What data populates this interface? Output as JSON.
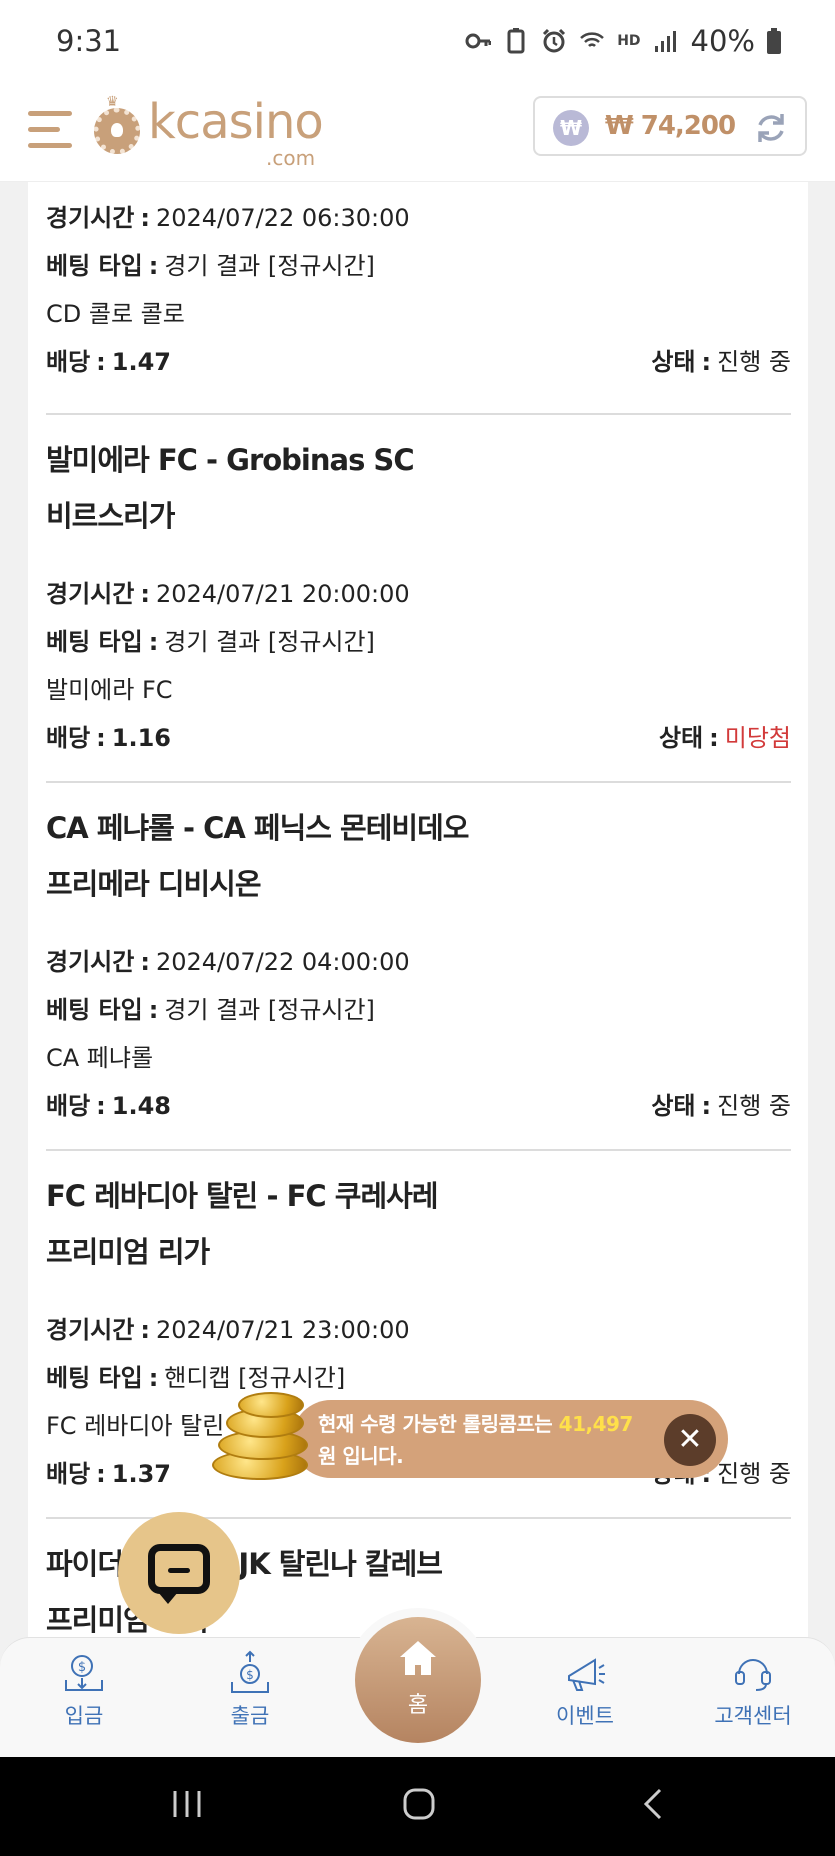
{
  "status_bar": {
    "time": "9:31",
    "network": "HD",
    "battery": "40%"
  },
  "header": {
    "logo_text": "kcasino",
    "logo_domain": ".com",
    "currency_symbol": "₩",
    "balance": "₩ 74,200"
  },
  "labels": {
    "time": "경기시간",
    "bet_type": "베팅 타입",
    "odds": "배당",
    "status": "상태",
    "colon": ":"
  },
  "bets": [
    {
      "match": "",
      "league": "",
      "time": "2024/07/22 06:30:00",
      "bet_type": "경기 결과 [정규시간]",
      "pick": "CD 콜로 콜로",
      "odds": "1.47",
      "status": "진행 중"
    },
    {
      "match": "발미에라 FC - Grobinas SC",
      "league": "비르스리가",
      "time": "2024/07/21 20:00:00",
      "bet_type": "경기 결과 [정규시간]",
      "pick": "발미에라 FC",
      "odds": "1.16",
      "status": "미당첨"
    },
    {
      "match": "CA 페냐롤 - CA 페닉스 몬테비데오",
      "league": "프리메라 디비시온",
      "time": "2024/07/22 04:00:00",
      "bet_type": "경기 결과 [정규시간]",
      "pick": "CA 페냐롤",
      "odds": "1.48",
      "status": "진행 중"
    },
    {
      "match": "FC 레바디아 탈린 - FC 쿠레사레",
      "league": "프리미엄 리가",
      "time": "2024/07/21 23:00:00",
      "bet_type": "핸디캡 [정규시간]",
      "pick": "FC 레바디아 탈린",
      "odds": "1.37",
      "status": "진행 중"
    },
    {
      "match": "파이더 스콘드 - JK 탈린나 칼레브",
      "league": "프리미엄 리가"
    }
  ],
  "comp_banner": {
    "text_before": "현재 수령 가능한 롤링콤프는 ",
    "amount": "41,497",
    "text_after": "원 입니다.",
    "close": "✕"
  },
  "bottom_nav": {
    "deposit": "입금",
    "withdraw": "출금",
    "home": "홈",
    "event": "이벤트",
    "support": "고객센터"
  },
  "colors": {
    "accent": "#c8a07a",
    "lost_status": "#d23a3a",
    "nav_text": "#3f72b6"
  }
}
